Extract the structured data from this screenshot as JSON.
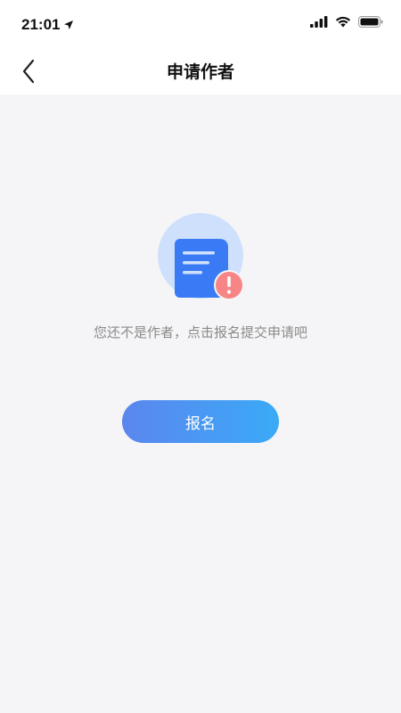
{
  "status_bar": {
    "time": "21:01",
    "icons": [
      "location-arrow-icon",
      "signal-icon",
      "wifi-icon",
      "battery-icon"
    ]
  },
  "nav": {
    "title": "申请作者",
    "back_icon": "chevron-left-icon"
  },
  "empty_state": {
    "illustration_icon": "document-warning-icon",
    "message": "您还不是作者，点击报名提交申请吧",
    "button_label": "报名"
  },
  "colors": {
    "accent_start": "#5b86ee",
    "accent_end": "#3aaaf7",
    "document_blue": "#3b7af5",
    "circle_light": "#cfe0fd",
    "warning_red": "#f88585",
    "background": "#f5f5f7"
  }
}
